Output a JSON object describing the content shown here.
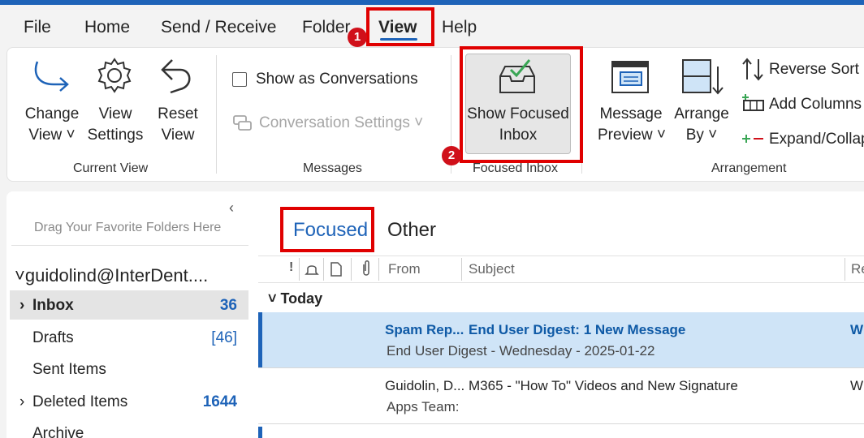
{
  "menu": {
    "file": "File",
    "home": "Home",
    "send_receive": "Send / Receive",
    "folder": "Folder",
    "view": "View",
    "help": "Help"
  },
  "ribbon": {
    "current_view": {
      "group_label": "Current View",
      "change_view": [
        "Change",
        "View ˅"
      ],
      "view_settings": [
        "View",
        "Settings"
      ],
      "reset_view": [
        "Reset",
        "View"
      ]
    },
    "messages": {
      "group_label": "Messages",
      "show_as_conversations": "Show as Conversations",
      "conversation_settings": "Conversation Settings ˅"
    },
    "focused_inbox": {
      "group_label": "Focused Inbox",
      "show_focused_inbox": [
        "Show Focused",
        "Inbox"
      ]
    },
    "arrangement": {
      "group_label": "Arrangement",
      "message_preview": [
        "Message",
        "Preview ˅"
      ],
      "arrange_by": [
        "Arrange",
        "By ˅"
      ],
      "reverse_sort": "Reverse Sort",
      "add_columns": "Add Columns",
      "expand_collapse": "Expand/Collap"
    }
  },
  "annotations": {
    "badge1": "1",
    "badge2": "2"
  },
  "folders": {
    "collapse": "‹",
    "drag_hint": "Drag Your Favorite Folders Here",
    "account": "guidolind@InterDent....",
    "items": [
      {
        "name": "Inbox",
        "count": "36",
        "chevron": "›"
      },
      {
        "name": "Drafts",
        "count": "[46]"
      },
      {
        "name": "Sent Items",
        "count": ""
      },
      {
        "name": "Deleted Items",
        "count": "1644",
        "chevron": "›"
      },
      {
        "name": "Archive",
        "count": ""
      }
    ]
  },
  "mail": {
    "tabs": {
      "focused": "Focused",
      "other": "Other"
    },
    "columns": {
      "from": "From",
      "subject": "Subject",
      "received": "Re"
    },
    "group_today": "Today",
    "messages": [
      {
        "from": "Spam Rep...",
        "subject": "End User Digest: 1 New Message",
        "preview": "End User Digest - Wednesday - 2025-01-22",
        "date": "W"
      },
      {
        "from": "Guidolin, D...",
        "subject": "M365 - \"How To\" Videos and New Signature",
        "preview": "Apps Team:",
        "date": "W"
      }
    ]
  },
  "colors": {
    "accent": "#1e63b8",
    "annotation": "#e00000",
    "selected_row": "#cfe4f7"
  }
}
